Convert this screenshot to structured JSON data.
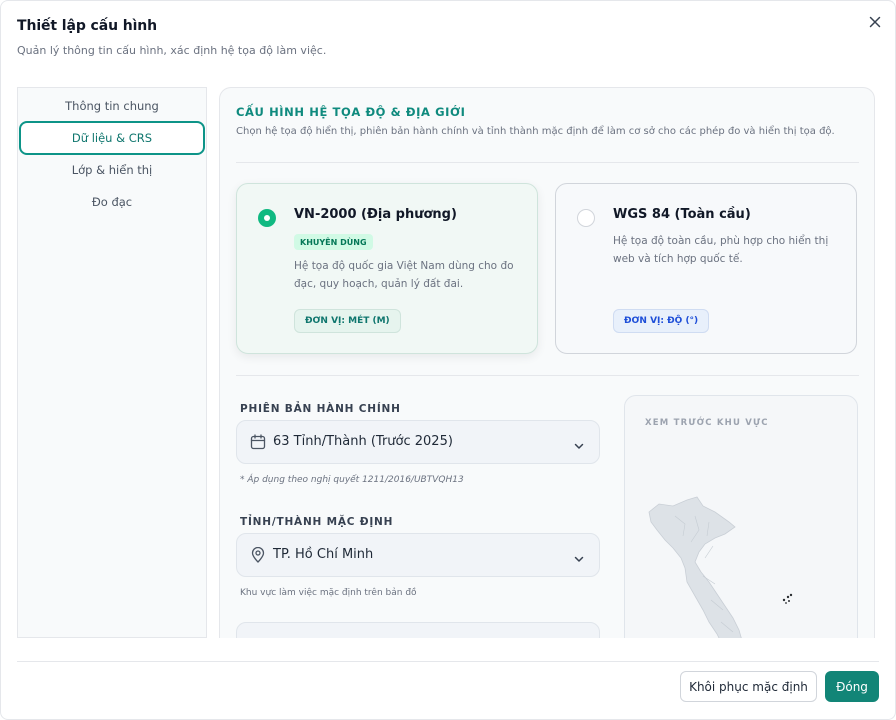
{
  "dialog": {
    "title": "Thiết lập cấu hình",
    "subtitle": "Quản lý thông tin cấu hình, xác định hệ tọa độ làm việc.",
    "close_icon": "close-icon"
  },
  "sidebar": {
    "items": [
      {
        "label": "Thông tin chung"
      },
      {
        "label": "Dữ liệu & CRS",
        "active": true
      },
      {
        "label": "Lớp & hiển thị"
      },
      {
        "label": "Đo đạc"
      }
    ]
  },
  "section": {
    "title": "CẤU HÌNH HỆ TỌA ĐỘ & ĐỊA GIỚI",
    "description": "Chọn hệ tọa độ hiển thị, phiên bản hành chính và tỉnh thành mặc định để làm cơ sở cho các phép đo và hiển thị tọa độ."
  },
  "crs_options": [
    {
      "title": "VN-2000 (Địa phương)",
      "badge": "KHUYÊN DÙNG",
      "description": "Hệ tọa độ quốc gia Việt Nam dùng cho đo đạc, quy hoạch, quản lý đất đai.",
      "unit": "ĐƠN VỊ: MÉT (M)",
      "selected": true
    },
    {
      "title": "WGS 84 (Toàn cầu)",
      "description": "Hệ tọa độ toàn cầu, phù hợp cho hiển thị web và tích hợp quốc tế.",
      "unit": "ĐƠN VỊ: ĐỘ (°)",
      "selected": false
    }
  ],
  "admin_version": {
    "label": "PHIÊN BẢN HÀNH CHÍNH",
    "value": "63 Tỉnh/Thành (Trước 2025)",
    "icon": "calendar-icon",
    "note": "* Áp dụng theo nghị quyết 1211/2016/UBTVQH13"
  },
  "default_province": {
    "label": "TỈNH/THÀNH MẶC ĐỊNH",
    "value": "TP. Hồ Chí Minh",
    "icon": "map-pin-icon",
    "note": "Khu vực làm việc mặc định trên bản đồ"
  },
  "preview": {
    "label": "XEM TRƯỚC KHU VỰC"
  },
  "footer": {
    "reset_label": "Khôi phục mặc định",
    "close_label": "Đóng"
  },
  "colors": {
    "accent": "#0d9488",
    "primary_button": "#128577",
    "selected_radio": "#10b981"
  }
}
